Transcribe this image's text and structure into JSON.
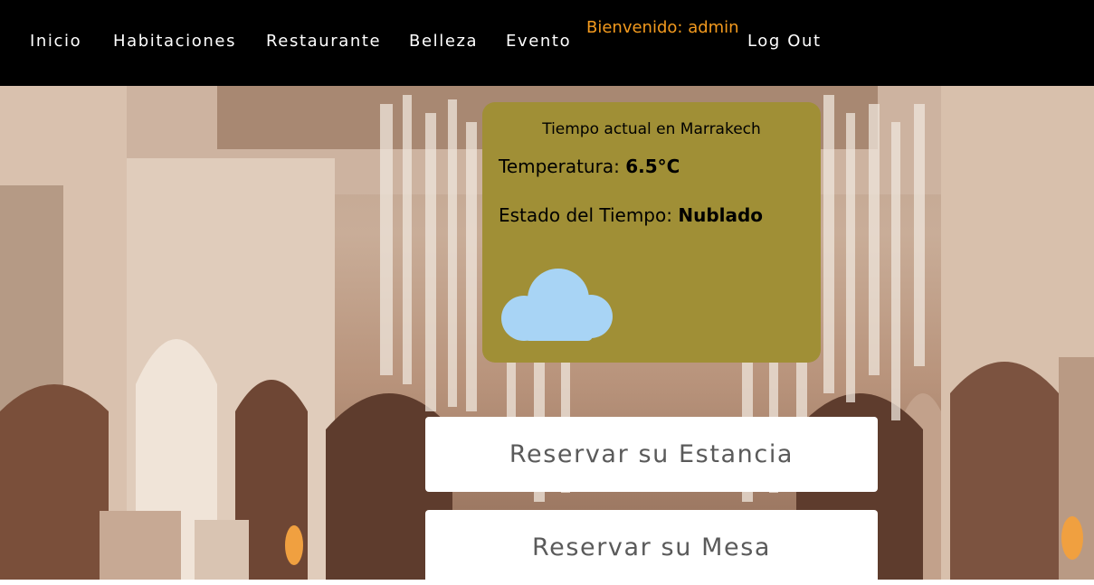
{
  "nav": {
    "items": [
      "Inicio",
      "Habitaciones",
      "Restaurante",
      "Belleza",
      "Evento"
    ],
    "welcome": "Bienvenido: admin",
    "logout": "Log Out"
  },
  "weather": {
    "title": "Tiempo actual en Marrakech",
    "temp_label": "Temperatura:",
    "temp_value": "6.5°C",
    "state_label": "Estado del Tiempo:",
    "state_value": "Nublado",
    "icon": "cloud-icon"
  },
  "buttons": {
    "stay": "Reservar su Estancia",
    "table": "Reservar su Mesa"
  },
  "colors": {
    "navbar": "#000000",
    "welcome": "#f39a1e",
    "weather_card": "#a08f36",
    "cloud": "#a8d4f5"
  }
}
